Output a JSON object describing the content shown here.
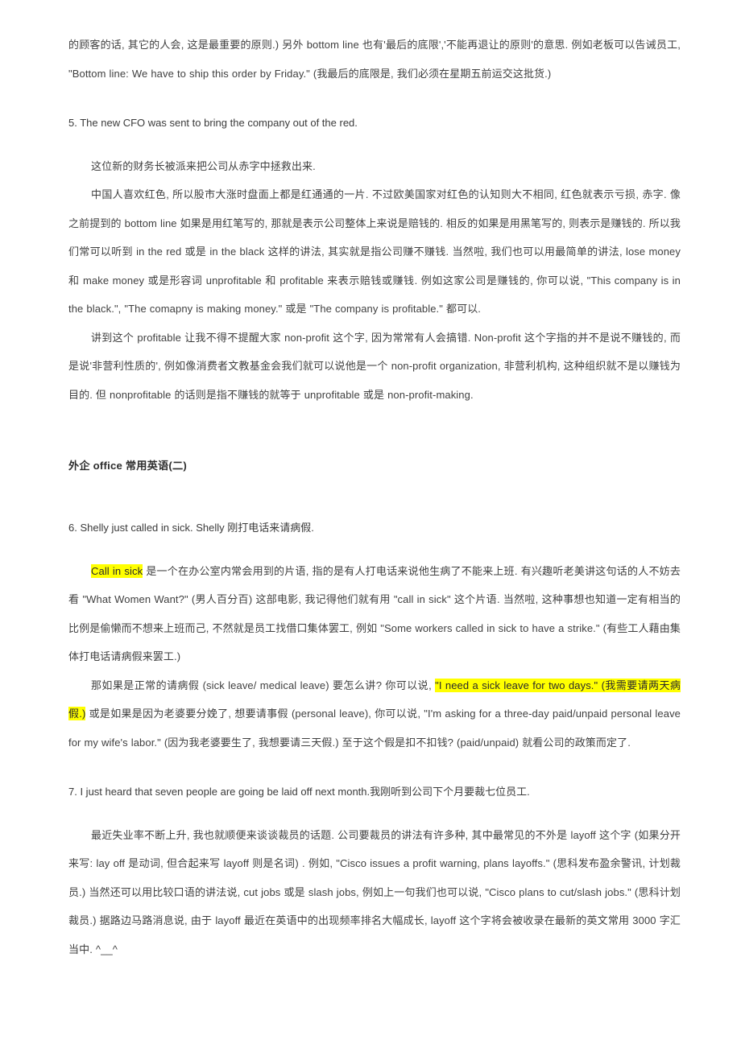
{
  "document": {
    "language": "zh-CN",
    "highlight_color": "#ffff00",
    "text_color": "#3f3f3f"
  },
  "blocks": {
    "top_paragraph": {
      "line1": "的顾客的话, 其它的人会, 这是最重要的原则.)  另外  bottom line  也有'最后的底限','不能再退让的原则'的意思. 例如老板可",
      "line2": "以告诫员工, \"Bottom line: We have to ship this order by Friday.\" (我最后的底限是, 我们必须在星期五前运交这批货.)",
      "full": "的顾客的话, 其它的人会, 这是最重要的原则.)  另外  bottom line  也有'最后的底限','不能再退让的原则'的意思. 例如老板可以告诫员工, \"Bottom line: We have to ship this order by Friday.\" (我最后的底限是, 我们必须在星期五前运交这批货.)"
    },
    "item5": {
      "number_sentence": "5. The new CFO was sent to bring the company out of the red.",
      "translation": "这位新的财务长被派来把公司从赤字中拯救出来.",
      "explain_1": "中国人喜欢红色, 所以股市大涨时盘面上都是红通通的一片. 不过欧美国家对红色的认知则大不相同, 红色就表示亏损, 赤字. 像之前提到的  bottom line  如果是用红笔写的, 那就是表示公司整体上来说是赔钱的. 相反的如果是用黑笔写的, 则表示是赚钱的. 所以我们常可以听到  in the red  或是  in the black  这样的讲法, 其实就是指公司赚不赚钱. 当然啦, 我们也可以用最简单的讲法, lose money  和  make money  或是形容词  unprofitable  和  profitable  来表示赔钱或赚钱. 例如这家公司是赚钱的, 你可以说, \"This company is in the black.\", \"The comapny is making money.\" 或是 \"The company is profitable.\"  都可以.",
      "explain_2": "讲到这个  profitable  让我不得不提醒大家  non-profit  这个字, 因为常常有人会搞错. Non-profit  这个字指的并不是说不赚钱的, 而是说'非营利性质的', 例如像消费者文教基金会我们就可以说他是一个  non-profit organization,  非营利机构, 这种组织就不是以赚钱为目的. 但  nonprofitable  的话则是指不赚钱的就等于  unprofitable  或是  non-profit-making."
    },
    "heading": {
      "text": "外企 office 常用英语(二)"
    },
    "item6": {
      "number_sentence": "6. Shelly just called in sick. Shelly  刚打电话来请病假.",
      "explain_1_highlight": "Call in sick",
      "explain_1_rest": "  是一个在办公室内常会用到的片语, 指的是有人打电话来说他生病了不能来上班. 有兴趣听老美讲这句话的人不妨去看 \"What Women Want?\" (男人百分百) 这部电影, 我记得他们就有用 \"call in sick\" 这个片语. 当然啦, 这种事想也知道一定有相当的比例是偷懒而不想来上班而己, 不然就是员工找借口集体罢工, 例如 \"Some workers called in sick to have a strike.\" (有些工人藉由集体打电话请病假来罢工.)",
      "explain_2_pre": "那如果是正常的请病假 (sick leave/ medical leave) 要怎么讲?  你可以说, ",
      "explain_2_highlight": "\"I need a sick leave for two days.\" (我需要请两天病假.)",
      "explain_2_post": " 或是如果是因为老婆要分娩了, 想要请事假 (personal leave), 你可以说, \"I'm asking for a three-day paid/unpaid personal leave for my wife's labor.\" (因为我老婆要生了, 我想要请三天假.) 至于这个假是扣不扣钱? (paid/unpaid) 就看公司的政策而定了."
    },
    "item7": {
      "number_sentence": "7. I just heard that seven people are going be laid off next month.我刚听到公司下个月要裁七位员工.",
      "explain_1": "最近失业率不断上升, 我也就顺便来谈谈裁员的话题. 公司要裁员的讲法有许多种, 其中最常见的不外是  layoff  这个字 (如果分开来写: lay off  是动词, 但合起来写  layoff  则是名词) . 例如, \"Cisco issues a profit warning, plans layoffs.\" (思科发布盈余警讯, 计划裁员.)  当然还可以用比较口语的讲法说, cut jobs  或是  slash jobs, 例如上一句我们也可以说, \"Cisco plans to cut/slash jobs.\" (思科计划裁员.) 据路边马路消息说, 由于  layoff  最近在英语中的出现频率排名大幅成长, layoff  这个字将会被收录在最新的英文常用  3000  字汇当中. ^__^"
    }
  }
}
